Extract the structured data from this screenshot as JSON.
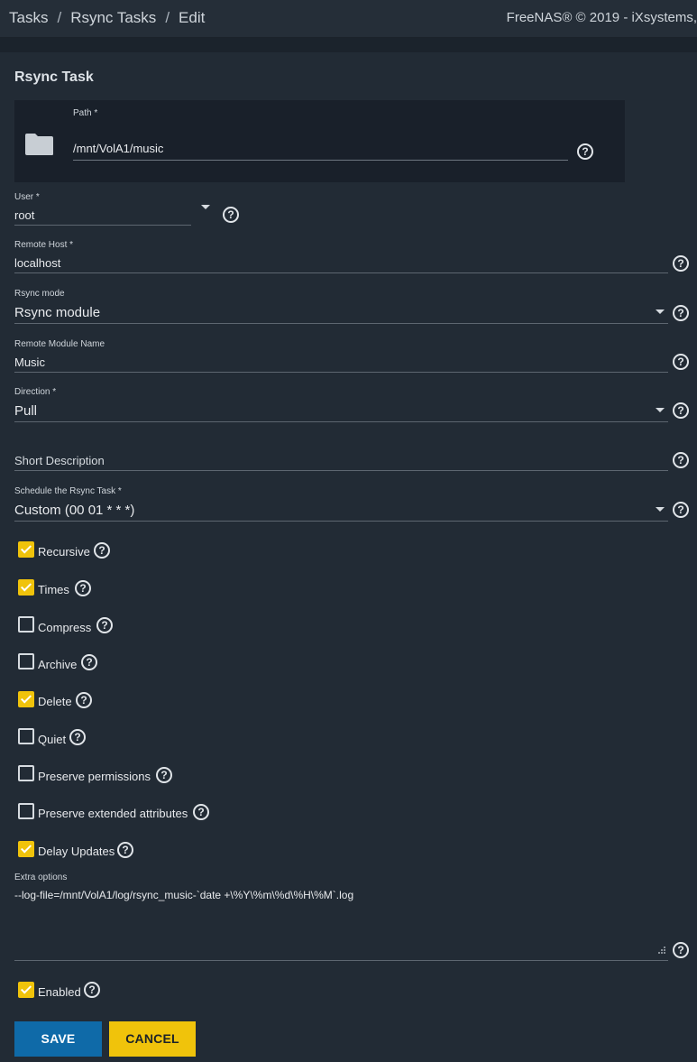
{
  "header": {
    "breadcrumbs": [
      "Tasks",
      "Rsync Tasks",
      "Edit"
    ],
    "separator": "/",
    "copyright": "FreeNAS® © 2019 - iXsystems,"
  },
  "form": {
    "title": "Rsync Task",
    "path": {
      "label": "Path *",
      "value": "/mnt/VolA1/music",
      "icon": "folder-icon"
    },
    "user": {
      "label": "User *",
      "value": "root"
    },
    "remote_host": {
      "label": "Remote Host *",
      "value": "localhost"
    },
    "rsync_mode": {
      "label": "Rsync mode",
      "value": "Rsync module"
    },
    "remote_module": {
      "label": "Remote Module Name",
      "value": "Music"
    },
    "direction": {
      "label": "Direction *",
      "value": "Pull"
    },
    "short_description": {
      "placeholder": "Short Description",
      "value": ""
    },
    "schedule": {
      "label": "Schedule the Rsync Task *",
      "value": "Custom (00 01 * * *)"
    },
    "checkboxes": [
      {
        "label": "Recursive",
        "checked": true
      },
      {
        "label": "Times",
        "checked": true
      },
      {
        "label": "Compress",
        "checked": false
      },
      {
        "label": "Archive",
        "checked": false
      },
      {
        "label": "Delete",
        "checked": true
      },
      {
        "label": "Quiet",
        "checked": false
      },
      {
        "label": "Preserve permissions",
        "checked": false
      },
      {
        "label": "Preserve extended attributes",
        "checked": false
      },
      {
        "label": "Delay Updates",
        "checked": true
      }
    ],
    "extra_options": {
      "label": "Extra options",
      "value": "--log-file=/mnt/VolA1/log/rsync_music-`date +\\%Y\\%m\\%d\\%H\\%M`.log"
    },
    "enabled": {
      "label": "Enabled",
      "checked": true
    },
    "help_glyph": "?"
  },
  "actions": {
    "save": "SAVE",
    "cancel": "CANCEL"
  },
  "colors": {
    "accent": "#f0c30b",
    "primary": "#0f6aa8",
    "background": "#222b35"
  }
}
